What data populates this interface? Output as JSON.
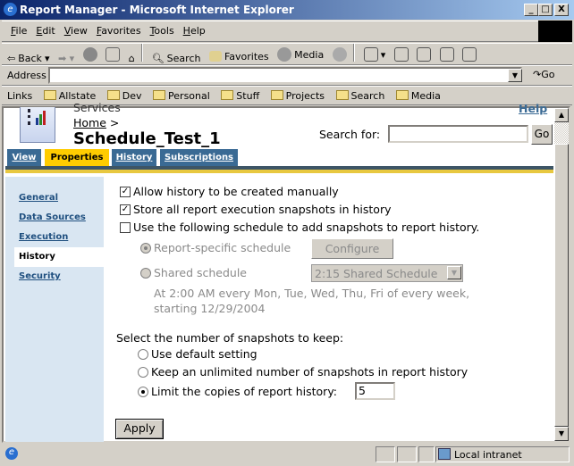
{
  "window": {
    "title": "Report Manager - Microsoft Internet Explorer",
    "minimize": "_",
    "maximize": "□",
    "close": "X"
  },
  "menu": [
    "File",
    "Edit",
    "View",
    "Favorites",
    "Tools",
    "Help"
  ],
  "toolbar": {
    "back": "Back",
    "search": "Search",
    "favorites": "Favorites",
    "media": "Media"
  },
  "address": {
    "label": "Address",
    "value": "",
    "go": "Go"
  },
  "links": {
    "label": "Links",
    "items": [
      "Allstate",
      "Dev",
      "Personal",
      "Stuff",
      "Projects",
      "Search",
      "Media"
    ]
  },
  "page": {
    "services": "Services",
    "breadcrumb": "Home",
    "breadcrumb_sep": ">",
    "title": "Schedule_Test_1",
    "help": "Help",
    "search_label": "Search for:",
    "search_value": "",
    "search_go": "Go",
    "tabs": [
      {
        "label": "View"
      },
      {
        "label": "Properties",
        "active": true
      },
      {
        "label": "History"
      },
      {
        "label": "Subscriptions"
      }
    ],
    "nav": [
      {
        "label": "General"
      },
      {
        "label": "Data Sources"
      },
      {
        "label": "Execution"
      },
      {
        "label": "History",
        "active": true
      },
      {
        "label": "Security"
      }
    ],
    "options": {
      "allow_manual": {
        "label": "Allow history to be created manually",
        "checked": true
      },
      "store_snapshots": {
        "label": "Store all report execution snapshots in history",
        "checked": true
      },
      "use_schedule": {
        "label": "Use the following schedule to add snapshots to report history.",
        "checked": false
      },
      "report_specific": {
        "label": "Report-specific schedule",
        "selected": true,
        "disabled": true
      },
      "configure": "Configure",
      "shared": {
        "label": "Shared schedule",
        "selected": false,
        "disabled": true
      },
      "shared_select": "2:15 Shared Schedule",
      "schedule_desc_1": "At 2:00 AM every Mon, Tue, Wed, Thu, Fri of every week,",
      "schedule_desc_2": "starting 12/29/2004"
    },
    "keep": {
      "heading": "Select the number of snapshots to keep:",
      "default": {
        "label": "Use default setting",
        "selected": false
      },
      "unlimited": {
        "label": "Keep an unlimited number of snapshots in report history",
        "selected": false
      },
      "limit": {
        "label": "Limit the copies of report history:",
        "selected": true,
        "value": "5"
      }
    },
    "apply": "Apply"
  },
  "status": {
    "zone": "Local intranet"
  },
  "colors": {
    "tab": "#3a6a94",
    "tab_active": "#ffcc00",
    "nav_bg": "#d9e6f2"
  }
}
